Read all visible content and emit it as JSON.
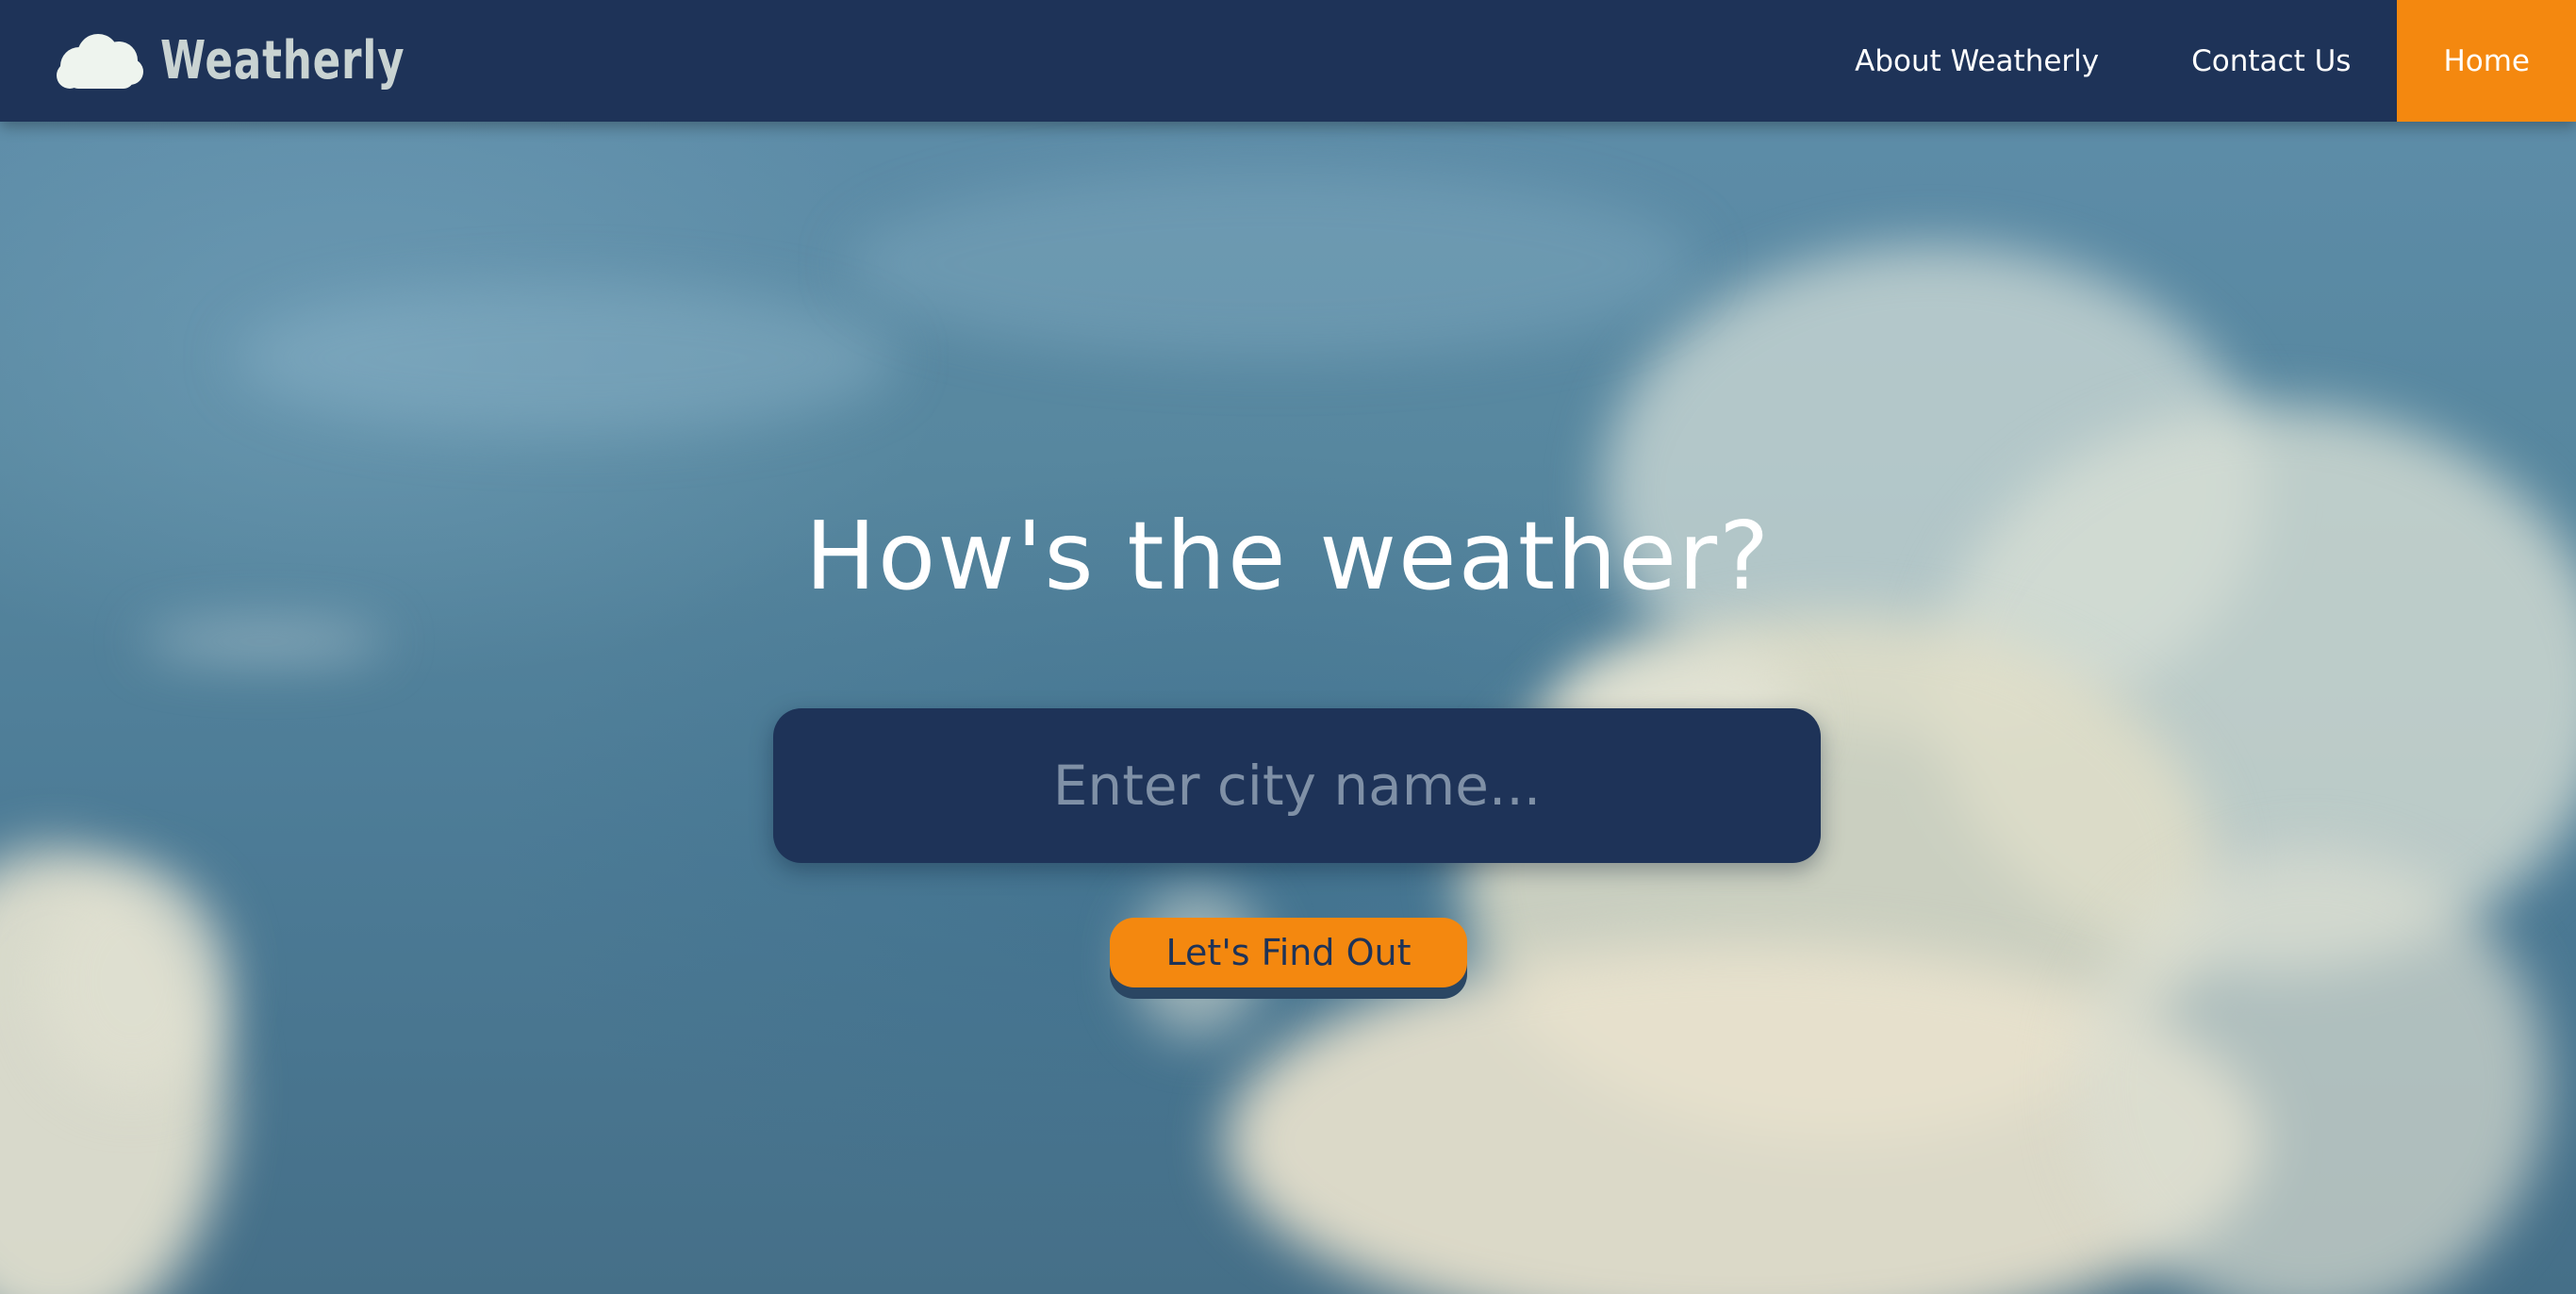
{
  "brand": {
    "name": "Weatherly",
    "icon": "cloud-icon"
  },
  "nav": {
    "items": [
      {
        "label": "About Weatherly",
        "active": false
      },
      {
        "label": "Contact Us",
        "active": false
      },
      {
        "label": "Home",
        "active": true
      }
    ]
  },
  "hero": {
    "title": "How's the weather?",
    "search_placeholder": "Enter city name...",
    "search_value": "",
    "button_label": "Let's Find Out"
  },
  "colors": {
    "navbar": "#1e3358",
    "accent": "#f4880f",
    "text_light": "#ffffff",
    "brand_text": "#c9d3d2",
    "placeholder": "#7f90a6"
  }
}
